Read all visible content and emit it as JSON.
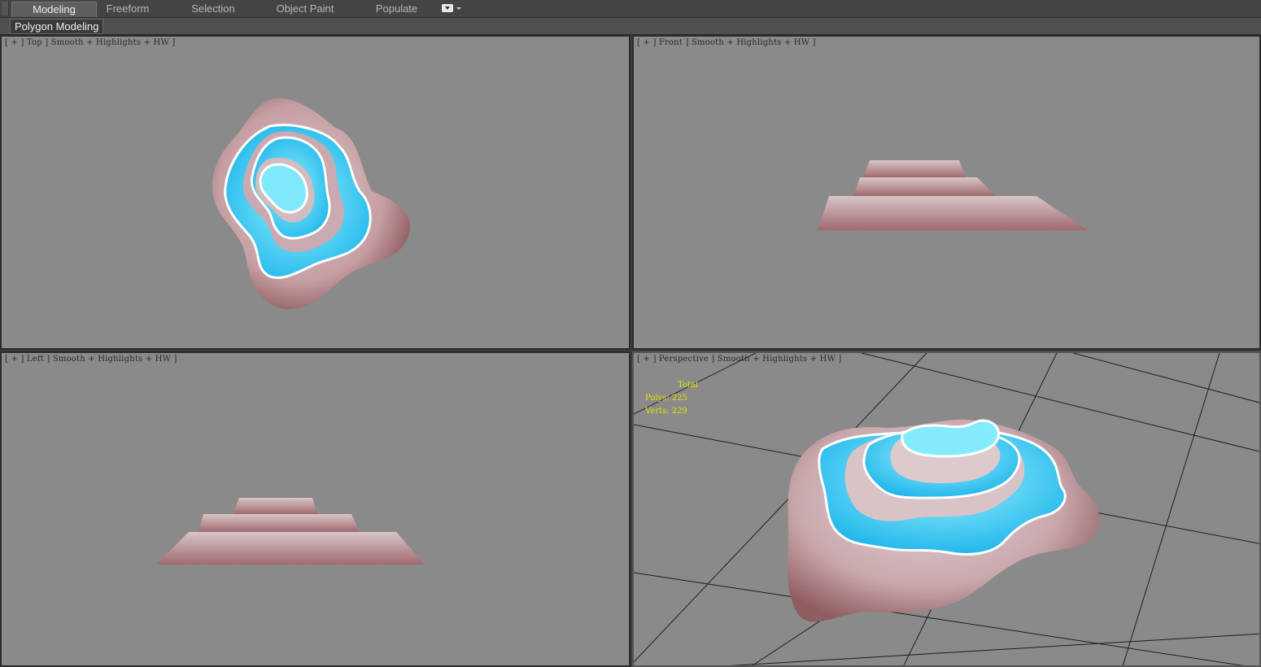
{
  "ribbon": {
    "tabs": [
      {
        "label": "Modeling",
        "active": true
      },
      {
        "label": "Freeform",
        "active": false
      },
      {
        "label": "Selection",
        "active": false
      },
      {
        "label": "Object Paint",
        "active": false
      },
      {
        "label": "Populate",
        "active": false
      }
    ],
    "more_icon": "dropdown-icon",
    "panel_label": "Polygon Modeling"
  },
  "viewports": {
    "top": {
      "label": "[ + ] Top ] Smooth + Highlights + HW ]"
    },
    "front": {
      "label": "[ + ] Front ] Smooth + Highlights + HW ]"
    },
    "left": {
      "label": "[ + ] Left ] Smooth + Highlights + HW ]"
    },
    "perspective": {
      "label": "[ + ] Perspective ] Smooth + Highlights + HW ]",
      "stats": {
        "title": "Total",
        "polys": "Polys: 225",
        "verts": "Verts: 229"
      }
    }
  },
  "colors": {
    "viewport_bg": "#8a8a8a",
    "rock_light": "#d9c4c8",
    "rock_dark": "#9b6468",
    "water": "#38c8f0",
    "stats_text": "#e8e000"
  }
}
